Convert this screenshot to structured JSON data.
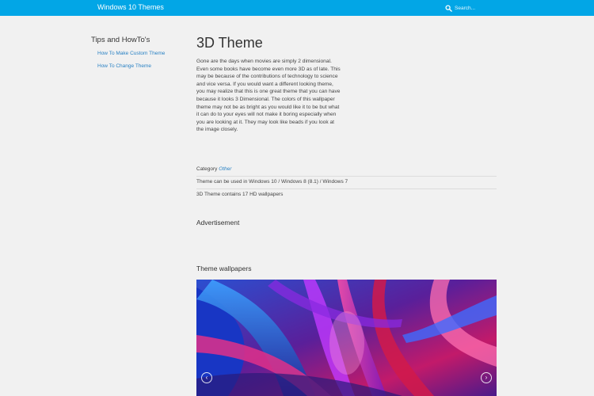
{
  "header": {
    "brand": "Windows 10 Themes",
    "search_placeholder": "Search...",
    "icons": {
      "search": "search-icon"
    }
  },
  "sidebar": {
    "title": "Tips and HowTo's",
    "links": [
      "How To Make Custom Theme",
      "How To Change Theme"
    ]
  },
  "main": {
    "title": "3D Theme",
    "description": "Gone are the days when movies are simply 2 dimensional. Even some books have become even more 3D as of late. This may be because of the contributions of technology to science and vice versa. If you would want a different looking theme, you may realize that this is one great theme that you can have because it looks 3 Dimensional. The colors of this wallpaper theme may not be as bright as you would like it to be but what it can do to your eyes will not make it boring especially when you are looking at it. They may look like beads if you look at the image closely.",
    "category_label": "Category",
    "category_value": "Other",
    "compat": "Theme can be used in Windows 10 / Windows 8 (8.1) / Windows 7",
    "contains": "3D Theme contains 17 HD wallpapers",
    "ad_heading": "Advertisement",
    "wallpapers_heading": "Theme wallpapers"
  },
  "carousel": {
    "prev_icon": "chevron-left-icon",
    "next_icon": "chevron-right-icon",
    "prev_glyph": "‹",
    "next_glyph": "›"
  },
  "colors": {
    "header_bg": "#02a6e6",
    "link": "#2a82c4",
    "page_bg": "#f1f1f1"
  }
}
